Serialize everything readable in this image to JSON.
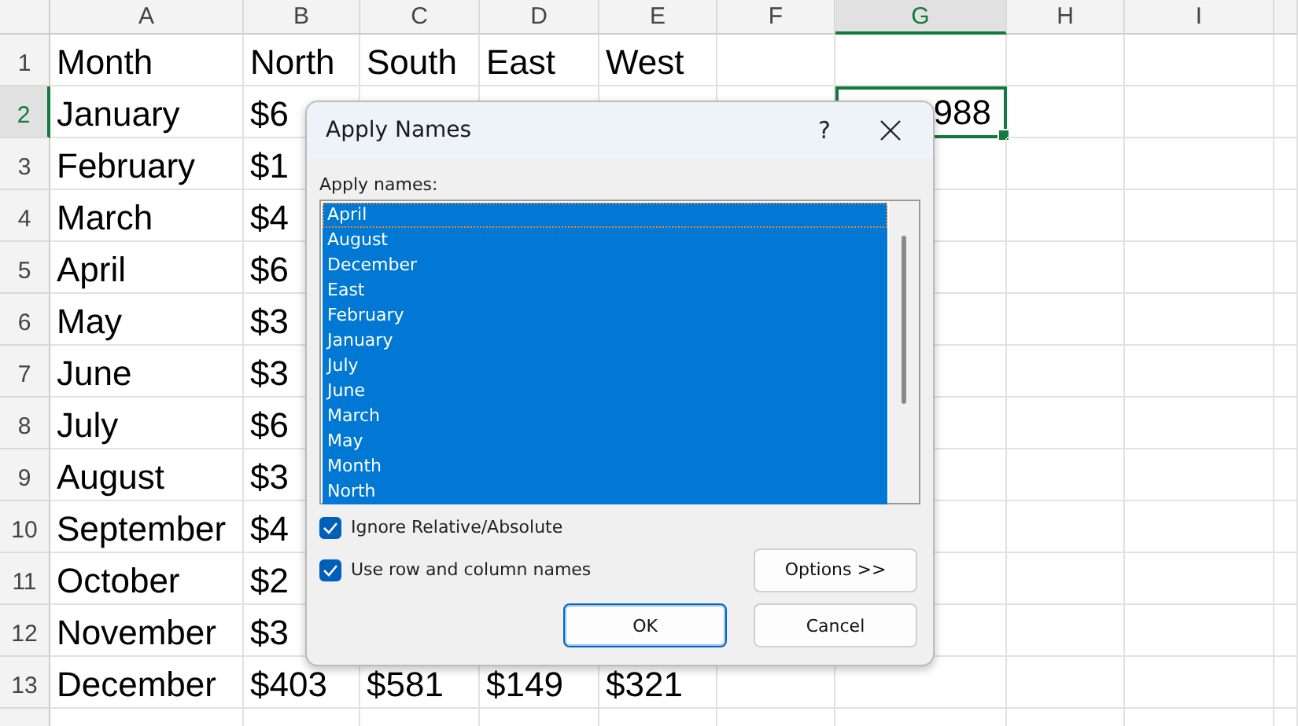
{
  "sheet": {
    "columns": [
      {
        "label": "A",
        "selected": false
      },
      {
        "label": "B",
        "selected": false
      },
      {
        "label": "C",
        "selected": false
      },
      {
        "label": "D",
        "selected": false
      },
      {
        "label": "E",
        "selected": false
      },
      {
        "label": "F",
        "selected": false
      },
      {
        "label": "G",
        "selected": true
      },
      {
        "label": "H",
        "selected": false
      },
      {
        "label": "I",
        "selected": false
      }
    ],
    "rows": [
      {
        "number": "1",
        "selected": false,
        "cells": [
          {
            "text": "Month"
          },
          {
            "text": "North"
          },
          {
            "text": "South"
          },
          {
            "text": "East"
          },
          {
            "text": "West"
          }
        ]
      },
      {
        "number": "2",
        "selected": true,
        "cells": [
          {
            "text": "January"
          },
          {
            "text": "$6"
          },
          null,
          null,
          null,
          null,
          {
            "text": "988",
            "active": true
          }
        ]
      },
      {
        "number": "3",
        "selected": false,
        "cells": [
          {
            "text": "February"
          },
          {
            "text": "$1"
          }
        ]
      },
      {
        "number": "4",
        "selected": false,
        "cells": [
          {
            "text": "March"
          },
          {
            "text": "$4"
          }
        ]
      },
      {
        "number": "5",
        "selected": false,
        "cells": [
          {
            "text": "April"
          },
          {
            "text": "$6"
          }
        ]
      },
      {
        "number": "6",
        "selected": false,
        "cells": [
          {
            "text": "May"
          },
          {
            "text": "$3"
          }
        ]
      },
      {
        "number": "7",
        "selected": false,
        "cells": [
          {
            "text": "June"
          },
          {
            "text": "$3"
          }
        ]
      },
      {
        "number": "8",
        "selected": false,
        "cells": [
          {
            "text": "July"
          },
          {
            "text": "$6"
          }
        ]
      },
      {
        "number": "9",
        "selected": false,
        "cells": [
          {
            "text": "August"
          },
          {
            "text": "$3"
          }
        ]
      },
      {
        "number": "10",
        "selected": false,
        "cells": [
          {
            "text": "September"
          },
          {
            "text": "$4"
          }
        ]
      },
      {
        "number": "11",
        "selected": false,
        "cells": [
          {
            "text": "October"
          },
          {
            "text": "$2"
          }
        ]
      },
      {
        "number": "12",
        "selected": false,
        "cells": [
          {
            "text": "November"
          },
          {
            "text": "$3"
          }
        ]
      },
      {
        "number": "13",
        "selected": false,
        "cells": [
          {
            "text": "December"
          },
          {
            "text": "$403"
          },
          {
            "text": "$581"
          },
          {
            "text": "$149"
          },
          {
            "text": "$321"
          }
        ]
      }
    ]
  },
  "dialog": {
    "title": "Apply Names",
    "help": "?",
    "list_label": "Apply names:",
    "names": [
      {
        "label": "April",
        "selected": true,
        "focused": true
      },
      {
        "label": "August",
        "selected": true,
        "focused": false
      },
      {
        "label": "December",
        "selected": true,
        "focused": false
      },
      {
        "label": "East",
        "selected": true,
        "focused": false
      },
      {
        "label": "February",
        "selected": true,
        "focused": false
      },
      {
        "label": "January",
        "selected": true,
        "focused": false
      },
      {
        "label": "July",
        "selected": true,
        "focused": false
      },
      {
        "label": "June",
        "selected": true,
        "focused": false
      },
      {
        "label": "March",
        "selected": true,
        "focused": false
      },
      {
        "label": "May",
        "selected": true,
        "focused": false
      },
      {
        "label": "Month",
        "selected": true,
        "focused": false
      },
      {
        "label": "North",
        "selected": true,
        "focused": false
      }
    ],
    "checkboxes": [
      {
        "label": "Ignore Relative/Absolute",
        "checked": true
      },
      {
        "label": "Use row and column names",
        "checked": true
      }
    ],
    "options_button": "Options >>",
    "buttons": [
      {
        "label": "OK",
        "default": true
      },
      {
        "label": "Cancel",
        "default": false
      }
    ]
  }
}
